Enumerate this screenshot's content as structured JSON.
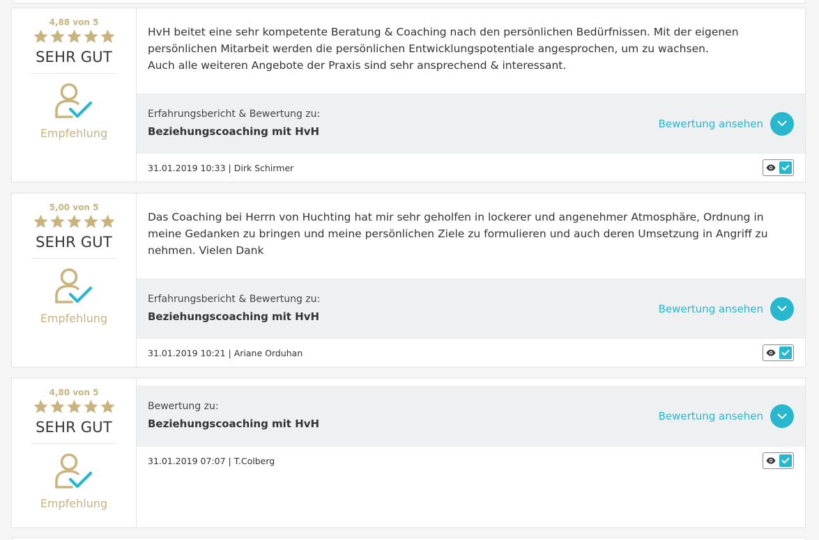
{
  "colors": {
    "gold": "#c9b37e",
    "accent": "#27b7cf",
    "product_bg": "#eff0f2"
  },
  "reviews": [
    {
      "score": "4,88 von 5",
      "stars": 5,
      "verdict": "SEHR GUT",
      "recommendation": "Empfehlung",
      "text_lines": [
        "HvH beitet eine sehr kompetente Beratung & Coaching nach den persönlichen Bedürfnissen. Mit der eigenen persönlichen Mitarbeit werden die persönlichen Entwicklungspotentiale angesprochen, um zu wachsen.",
        "Auch alle weiteren Angebote der Praxis sind sehr ansprechend & interessant."
      ],
      "product_caption": "Erfahrungsbericht & Bewertung zu:",
      "product_name": "Beziehungscoaching mit HvH",
      "view_label": "Bewertung ansehen",
      "meta": "31.01.2019 10:33 | Dirk Schirmer"
    },
    {
      "score": "5,00 von 5",
      "stars": 5,
      "verdict": "SEHR GUT",
      "recommendation": "Empfehlung",
      "text_lines": [
        "Das Coaching bei Herrn von Huchting hat mir sehr geholfen in lockerer und angenehmer Atmosphäre, Ordnung in meine Gedanken zu bringen und meine persönlichen Ziele zu formulieren und auch deren Umsetzung in Angriff zu nehmen. Vielen Dank"
      ],
      "product_caption": "Erfahrungsbericht & Bewertung zu:",
      "product_name": "Beziehungscoaching mit HvH",
      "view_label": "Bewertung ansehen",
      "meta": "31.01.2019 10:21 | Ariane Orduhan"
    },
    {
      "score": "4,80 von 5",
      "stars": 5,
      "verdict": "SEHR GUT",
      "recommendation": "Empfehlung",
      "text_lines": [],
      "product_caption": "Bewertung zu:",
      "product_name": "Beziehungscoaching mit HvH",
      "view_label": "Bewertung ansehen",
      "meta": "31.01.2019 07:07 | T.Colberg"
    }
  ],
  "icons": {
    "star": "star-icon",
    "recommendation": "user-check-icon",
    "chevron": "chevron-down-icon",
    "visibility": "eye-icon",
    "verified": "checkbox-checked-icon"
  }
}
